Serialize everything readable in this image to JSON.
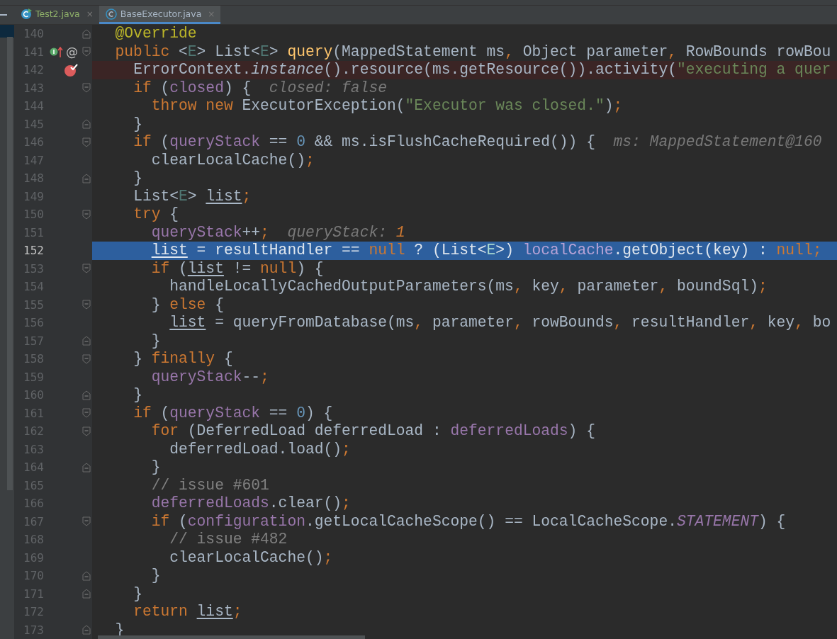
{
  "tabs": [
    {
      "label": "Test2.java",
      "selected": false,
      "close": "×"
    },
    {
      "label": "BaseExecutor.java",
      "selected": true,
      "close": "×"
    }
  ],
  "editor": {
    "lines": [
      {
        "number": "140",
        "fold": {
          "kind": "end"
        },
        "breakpoint": false,
        "current": false,
        "tokens": [
          {
            "kind": "annotation",
            "t": "  @Override"
          }
        ]
      },
      {
        "number": "141",
        "fold": {
          "kind": "start"
        },
        "breakpoint": false,
        "current": false,
        "gutter": [
          {
            "kind": "implements"
          },
          {
            "kind": "glyph",
            "text": "@"
          }
        ],
        "tokens": [
          {
            "kind": "kw",
            "t": "  public "
          },
          {
            "kind": "plain",
            "t": "<"
          },
          {
            "kind": "tparam",
            "t": "E"
          },
          {
            "kind": "plain",
            "t": "> List<"
          },
          {
            "kind": "tparam",
            "t": "E"
          },
          {
            "kind": "plain",
            "t": "> "
          },
          {
            "kind": "decl",
            "t": "query"
          },
          {
            "kind": "plain",
            "t": "(MappedStatement ms"
          },
          {
            "kind": "kw",
            "t": ","
          },
          {
            "kind": "plain",
            "t": " Object parameter"
          },
          {
            "kind": "kw",
            "t": ","
          },
          {
            "kind": "plain",
            "t": " RowBounds rowBou"
          }
        ]
      },
      {
        "number": "142",
        "breakpoint": true,
        "current": false,
        "tokens": [
          {
            "kind": "plain",
            "t": "    ErrorContext."
          },
          {
            "kind": "static",
            "t": "instance"
          },
          {
            "kind": "plain",
            "t": "().resource(ms.getResource()).activity("
          },
          {
            "kind": "str",
            "t": "\"executing a quer"
          }
        ]
      },
      {
        "number": "143",
        "fold": {
          "kind": "start"
        },
        "breakpoint": false,
        "current": false,
        "tokens": [
          {
            "kind": "kw",
            "t": "    if "
          },
          {
            "kind": "plain",
            "t": "("
          },
          {
            "kind": "field",
            "t": "closed"
          },
          {
            "kind": "plain",
            "t": ") {  "
          },
          {
            "kind": "hint",
            "t": "closed: false"
          }
        ]
      },
      {
        "number": "144",
        "breakpoint": false,
        "current": false,
        "tokens": [
          {
            "kind": "kw",
            "t": "      throw new "
          },
          {
            "kind": "plain",
            "t": "ExecutorException("
          },
          {
            "kind": "str",
            "t": "\"Executor was closed.\""
          },
          {
            "kind": "plain",
            "t": ")"
          },
          {
            "kind": "kw",
            "t": ";"
          }
        ]
      },
      {
        "number": "145",
        "fold": {
          "kind": "end"
        },
        "breakpoint": false,
        "current": false,
        "tokens": [
          {
            "kind": "plain",
            "t": "    }"
          }
        ]
      },
      {
        "number": "146",
        "fold": {
          "kind": "start"
        },
        "breakpoint": false,
        "current": false,
        "tokens": [
          {
            "kind": "kw",
            "t": "    if "
          },
          {
            "kind": "plain",
            "t": "("
          },
          {
            "kind": "field",
            "t": "queryStack"
          },
          {
            "kind": "plain",
            "t": " == "
          },
          {
            "kind": "num",
            "t": "0"
          },
          {
            "kind": "plain",
            "t": " && ms.isFlushCacheRequired()) {  "
          },
          {
            "kind": "hint",
            "t": "ms: MappedStatement@160"
          }
        ]
      },
      {
        "number": "147",
        "breakpoint": false,
        "current": false,
        "tokens": [
          {
            "kind": "plain",
            "t": "      clearLocalCache()"
          },
          {
            "kind": "kw",
            "t": ";"
          }
        ]
      },
      {
        "number": "148",
        "fold": {
          "kind": "end"
        },
        "breakpoint": false,
        "current": false,
        "tokens": [
          {
            "kind": "plain",
            "t": "    }"
          }
        ]
      },
      {
        "number": "149",
        "breakpoint": false,
        "current": false,
        "tokens": [
          {
            "kind": "plain",
            "t": "    List<"
          },
          {
            "kind": "tparam",
            "t": "E"
          },
          {
            "kind": "plain",
            "t": "> "
          },
          {
            "kind": "local",
            "t": "list"
          },
          {
            "kind": "kw",
            "t": ";"
          }
        ]
      },
      {
        "number": "150",
        "fold": {
          "kind": "start"
        },
        "breakpoint": false,
        "current": false,
        "tokens": [
          {
            "kind": "kw",
            "t": "    try "
          },
          {
            "kind": "plain",
            "t": "{"
          }
        ]
      },
      {
        "number": "151",
        "breakpoint": false,
        "current": false,
        "tokens": [
          {
            "kind": "field",
            "t": "      queryStack"
          },
          {
            "kind": "plain",
            "t": "++"
          },
          {
            "kind": "kw",
            "t": ";"
          },
          {
            "kind": "hint",
            "t": "  queryStack: "
          },
          {
            "kind": "hintval",
            "t": "1"
          }
        ]
      },
      {
        "number": "152",
        "breakpoint": false,
        "current": true,
        "tokens": [
          {
            "kind": "local",
            "t": "      list"
          },
          {
            "kind": "plain",
            "t": " = resultHandler == "
          },
          {
            "kind": "kw",
            "t": "null"
          },
          {
            "kind": "plain",
            "t": " ? (List<"
          },
          {
            "kind": "tparam",
            "t": "E"
          },
          {
            "kind": "plain",
            "t": ">) "
          },
          {
            "kind": "field",
            "t": "localCache"
          },
          {
            "kind": "plain",
            "t": ".getObject(key) : "
          },
          {
            "kind": "kw",
            "t": "null;"
          }
        ]
      },
      {
        "number": "153",
        "fold": {
          "kind": "start"
        },
        "breakpoint": false,
        "current": false,
        "tokens": [
          {
            "kind": "kw",
            "t": "      if "
          },
          {
            "kind": "plain",
            "t": "("
          },
          {
            "kind": "local",
            "t": "list"
          },
          {
            "kind": "plain",
            "t": " != "
          },
          {
            "kind": "kw",
            "t": "null"
          },
          {
            "kind": "plain",
            "t": ") {"
          }
        ]
      },
      {
        "number": "154",
        "breakpoint": false,
        "current": false,
        "tokens": [
          {
            "kind": "plain",
            "t": "        handleLocallyCachedOutputParameters(ms"
          },
          {
            "kind": "kw",
            "t": ","
          },
          {
            "kind": "plain",
            "t": " key"
          },
          {
            "kind": "kw",
            "t": ","
          },
          {
            "kind": "plain",
            "t": " parameter"
          },
          {
            "kind": "kw",
            "t": ","
          },
          {
            "kind": "plain",
            "t": " boundSql)"
          },
          {
            "kind": "kw",
            "t": ";"
          }
        ]
      },
      {
        "number": "155",
        "fold": {
          "kind": "start"
        },
        "breakpoint": false,
        "current": false,
        "tokens": [
          {
            "kind": "plain",
            "t": "      } "
          },
          {
            "kind": "kw",
            "t": "else "
          },
          {
            "kind": "plain",
            "t": "{"
          }
        ]
      },
      {
        "number": "156",
        "breakpoint": false,
        "current": false,
        "tokens": [
          {
            "kind": "local",
            "t": "        list"
          },
          {
            "kind": "plain",
            "t": " = queryFromDatabase(ms"
          },
          {
            "kind": "kw",
            "t": ","
          },
          {
            "kind": "plain",
            "t": " parameter"
          },
          {
            "kind": "kw",
            "t": ","
          },
          {
            "kind": "plain",
            "t": " rowBounds"
          },
          {
            "kind": "kw",
            "t": ","
          },
          {
            "kind": "plain",
            "t": " resultHandler"
          },
          {
            "kind": "kw",
            "t": ","
          },
          {
            "kind": "plain",
            "t": " key"
          },
          {
            "kind": "kw",
            "t": ","
          },
          {
            "kind": "plain",
            "t": " bo"
          }
        ]
      },
      {
        "number": "157",
        "fold": {
          "kind": "end"
        },
        "breakpoint": false,
        "current": false,
        "tokens": [
          {
            "kind": "plain",
            "t": "      }"
          }
        ]
      },
      {
        "number": "158",
        "fold": {
          "kind": "start"
        },
        "breakpoint": false,
        "current": false,
        "tokens": [
          {
            "kind": "plain",
            "t": "    } "
          },
          {
            "kind": "kw",
            "t": "finally "
          },
          {
            "kind": "plain",
            "t": "{"
          }
        ]
      },
      {
        "number": "159",
        "breakpoint": false,
        "current": false,
        "tokens": [
          {
            "kind": "field",
            "t": "      queryStack"
          },
          {
            "kind": "plain",
            "t": "--"
          },
          {
            "kind": "kw",
            "t": ";"
          }
        ]
      },
      {
        "number": "160",
        "fold": {
          "kind": "end"
        },
        "breakpoint": false,
        "current": false,
        "tokens": [
          {
            "kind": "plain",
            "t": "    }"
          }
        ]
      },
      {
        "number": "161",
        "fold": {
          "kind": "start"
        },
        "breakpoint": false,
        "current": false,
        "tokens": [
          {
            "kind": "kw",
            "t": "    if "
          },
          {
            "kind": "plain",
            "t": "("
          },
          {
            "kind": "field",
            "t": "queryStack"
          },
          {
            "kind": "plain",
            "t": " == "
          },
          {
            "kind": "num",
            "t": "0"
          },
          {
            "kind": "plain",
            "t": ") {"
          }
        ]
      },
      {
        "number": "162",
        "fold": {
          "kind": "start"
        },
        "breakpoint": false,
        "current": false,
        "tokens": [
          {
            "kind": "kw",
            "t": "      for "
          },
          {
            "kind": "plain",
            "t": "(DeferredLoad deferredLoad : "
          },
          {
            "kind": "field",
            "t": "deferredLoads"
          },
          {
            "kind": "plain",
            "t": ") {"
          }
        ]
      },
      {
        "number": "163",
        "breakpoint": false,
        "current": false,
        "tokens": [
          {
            "kind": "plain",
            "t": "        deferredLoad.load()"
          },
          {
            "kind": "kw",
            "t": ";"
          }
        ]
      },
      {
        "number": "164",
        "fold": {
          "kind": "end"
        },
        "breakpoint": false,
        "current": false,
        "tokens": [
          {
            "kind": "plain",
            "t": "      }"
          }
        ]
      },
      {
        "number": "165",
        "breakpoint": false,
        "current": false,
        "tokens": [
          {
            "kind": "comment",
            "t": "      // issue #601"
          }
        ]
      },
      {
        "number": "166",
        "breakpoint": false,
        "current": false,
        "tokens": [
          {
            "kind": "field",
            "t": "      deferredLoads"
          },
          {
            "kind": "plain",
            "t": ".clear()"
          },
          {
            "kind": "kw",
            "t": ";"
          }
        ]
      },
      {
        "number": "167",
        "fold": {
          "kind": "start"
        },
        "breakpoint": false,
        "current": false,
        "tokens": [
          {
            "kind": "kw",
            "t": "      if "
          },
          {
            "kind": "plain",
            "t": "("
          },
          {
            "kind": "field",
            "t": "configuration"
          },
          {
            "kind": "plain",
            "t": ".getLocalCacheScope() == LocalCacheScope."
          },
          {
            "kind": "staticfield",
            "t": "STATEMENT"
          },
          {
            "kind": "plain",
            "t": ") {"
          }
        ]
      },
      {
        "number": "168",
        "breakpoint": false,
        "current": false,
        "tokens": [
          {
            "kind": "comment",
            "t": "        // issue #482"
          }
        ]
      },
      {
        "number": "169",
        "breakpoint": false,
        "current": false,
        "tokens": [
          {
            "kind": "plain",
            "t": "        clearLocalCache()"
          },
          {
            "kind": "kw",
            "t": ";"
          }
        ]
      },
      {
        "number": "170",
        "fold": {
          "kind": "end"
        },
        "breakpoint": false,
        "current": false,
        "tokens": [
          {
            "kind": "plain",
            "t": "      }"
          }
        ]
      },
      {
        "number": "171",
        "fold": {
          "kind": "end"
        },
        "breakpoint": false,
        "current": false,
        "tokens": [
          {
            "kind": "plain",
            "t": "    }"
          }
        ]
      },
      {
        "number": "172",
        "breakpoint": false,
        "current": false,
        "tokens": [
          {
            "kind": "kw",
            "t": "    return "
          },
          {
            "kind": "local",
            "t": "list"
          },
          {
            "kind": "kw",
            "t": ";"
          }
        ]
      },
      {
        "number": "173",
        "fold": {
          "kind": "end"
        },
        "breakpoint": false,
        "current": false,
        "tokens": [
          {
            "kind": "plain",
            "t": "  }"
          }
        ]
      }
    ]
  }
}
